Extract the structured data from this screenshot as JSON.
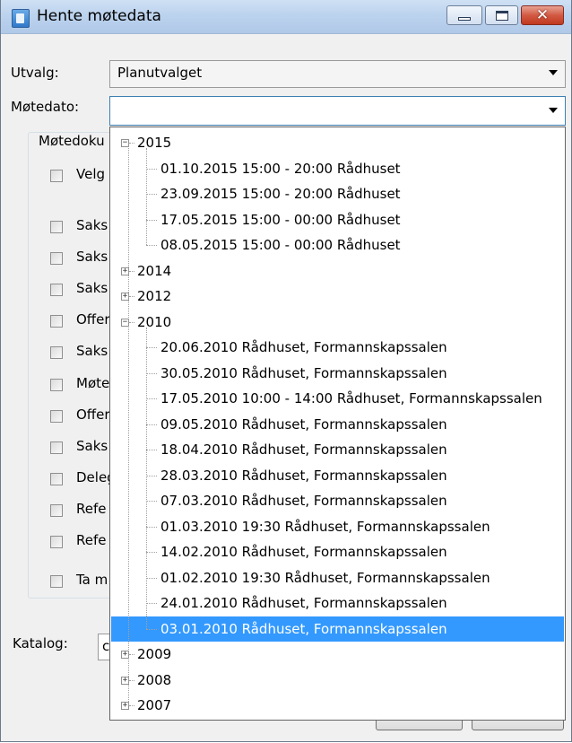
{
  "window": {
    "title": "Hente møtedata",
    "controls": {
      "minimize": "–",
      "maximize": "□",
      "close": "✕"
    }
  },
  "form": {
    "utvalg_label": "Utvalg:",
    "utvalg_value": "Planutvalget",
    "motedato_label": "Møtedato:",
    "motedato_value": "",
    "group_title": "Møtedoku",
    "checkboxes": [
      "Velg",
      "Saks",
      "Saks",
      "Saks",
      "Offer",
      "Saks",
      "Møte",
      "Offer",
      "Saks",
      "Deleg",
      "Refe",
      "Refe",
      "Ta m"
    ],
    "katalog_label": "Katalog:",
    "katalog_value": "c"
  },
  "tree": {
    "years": [
      {
        "year": "2015",
        "expanded": true,
        "expander": "−",
        "items": [
          "01.10.2015 15:00 - 20:00 Rådhuset",
          "23.09.2015 15:00 - 20:00 Rådhuset",
          "17.05.2015 15:00 - 00:00 Rådhuset",
          "08.05.2015 15:00 - 00:00 Rådhuset"
        ]
      },
      {
        "year": "2014",
        "expanded": false,
        "expander": "+"
      },
      {
        "year": "2012",
        "expanded": false,
        "expander": "+"
      },
      {
        "year": "2010",
        "expanded": true,
        "expander": "−",
        "items": [
          "20.06.2010  Rådhuset, Formannskapssalen",
          "30.05.2010  Rådhuset, Formannskapssalen",
          "17.05.2010 10:00 - 14:00 Rådhuset, Formannskapssalen",
          "09.05.2010  Rådhuset, Formannskapssalen",
          "18.04.2010  Rådhuset, Formannskapssalen",
          "28.03.2010  Rådhuset, Formannskapssalen",
          "07.03.2010  Rådhuset, Formannskapssalen",
          "01.03.2010 19:30 Rådhuset, Formannskapssalen",
          "14.02.2010  Rådhuset, Formannskapssalen",
          "01.02.2010 19:30 Rådhuset, Formannskapssalen",
          "24.01.2010  Rådhuset, Formannskapssalen",
          "03.01.2010  Rådhuset, Formannskapssalen"
        ],
        "selected_item": "03.01.2010  Rådhuset, Formannskapssalen"
      },
      {
        "year": "2009",
        "expanded": false,
        "expander": "+"
      },
      {
        "year": "2008",
        "expanded": false,
        "expander": "+"
      },
      {
        "year": "2007",
        "expanded": false,
        "expander": "+"
      }
    ]
  },
  "colors": {
    "selection": "#3399ff",
    "close_button": "#c0391f",
    "titlebar": "#bcd3ee",
    "focus_border": "#3c7fb1"
  }
}
